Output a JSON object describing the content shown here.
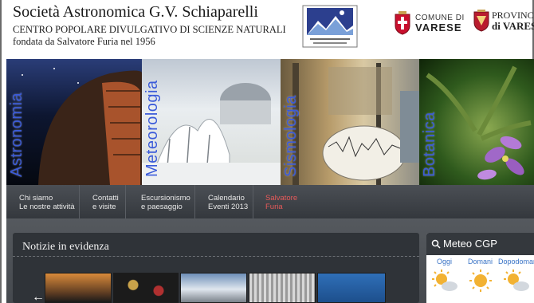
{
  "header": {
    "title": "Società Astronomica G.V. Schiaparelli",
    "subtitle1": "CENTRO POPOLARE DIVULGATIVO DI SCIENZE NATURALI",
    "subtitle2": "fondata da Salvatore Furia nel 1956",
    "comune": {
      "line1": "COMUNE DI",
      "line2": "VARESE"
    },
    "provincia": {
      "line1": "PROVINCIA",
      "line2": "di VARESE"
    }
  },
  "banner": [
    {
      "label": "Astronomia"
    },
    {
      "label": "Meteorologia"
    },
    {
      "label": "Sismologia"
    },
    {
      "label": "Botanica"
    }
  ],
  "menu": [
    {
      "line1": "Chi siamo",
      "line2": "Le nostre attività"
    },
    {
      "line1": "Contatti",
      "line2": "e visite"
    },
    {
      "line1": "Escursionismo",
      "line2": "e paesaggio"
    },
    {
      "line1": "Calendario",
      "line2": "Eventi 2013"
    },
    {
      "line1": "Salvatore",
      "line2": "Furia",
      "active": true
    }
  ],
  "news": {
    "title": "Notizie in evidenza",
    "prev_arrow": "←"
  },
  "meteo": {
    "title": "Meteo CGP",
    "days": [
      "Oggi",
      "Domani",
      "Dopodomani"
    ]
  },
  "colors": {
    "menu_active": "#e65a5a",
    "banner_label": "#3b5bd9",
    "days": "#3a74c6"
  }
}
